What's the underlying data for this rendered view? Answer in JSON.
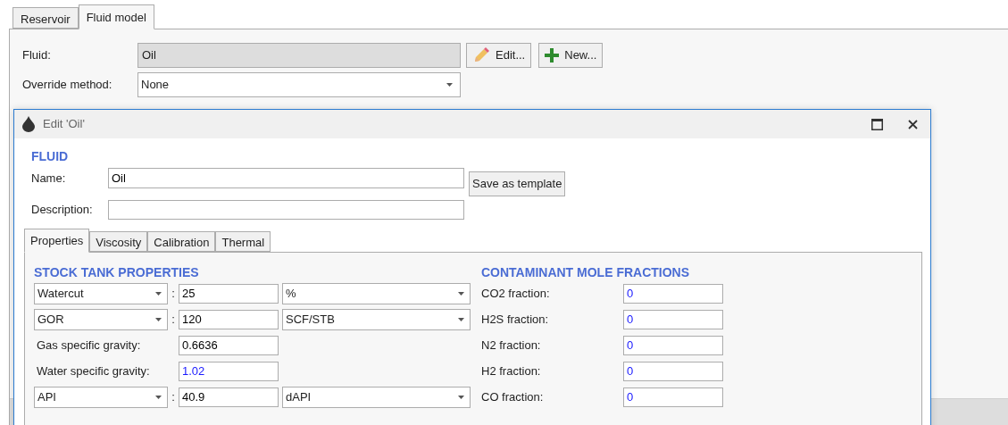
{
  "main_tabs": [
    {
      "label": "Reservoir",
      "selected": false
    },
    {
      "label": "Fluid model",
      "selected": true
    }
  ],
  "fluid": {
    "label": "Fluid:",
    "value": "Oil"
  },
  "fluid_buttons": [
    {
      "kind": "edit",
      "label": "Edit..."
    },
    {
      "kind": "new",
      "label": "New..."
    }
  ],
  "override": {
    "label": "Override method:",
    "value": "None"
  },
  "dialog": {
    "title": "Edit 'Oil'",
    "section": "FLUID",
    "name": {
      "label": "Name:",
      "value": "Oil"
    },
    "save_button": "Save as template",
    "description": {
      "label": "Description:"
    },
    "tabs": [
      {
        "label": "Properties",
        "selected": true
      },
      {
        "label": "Viscosity",
        "selected": false
      },
      {
        "label": "Calibration",
        "selected": false
      },
      {
        "label": "Thermal",
        "selected": false
      }
    ],
    "stock_tank": {
      "heading": "STOCK TANK PROPERTIES",
      "rows": [
        {
          "kind": "selector",
          "property": "Watercut",
          "separator": ":",
          "value": "25",
          "unit": "%",
          "default_value": false
        },
        {
          "kind": "selector",
          "property": "GOR",
          "separator": ":",
          "value": "120",
          "unit": "SCF/STB",
          "default_value": false
        },
        {
          "kind": "fixed",
          "label": "Gas specific gravity:",
          "value": "0.6636",
          "default_value": false
        },
        {
          "kind": "fixed",
          "label": "Water specific gravity:",
          "value": "1.02",
          "default_value": true
        },
        {
          "kind": "selector",
          "property": "API",
          "separator": ":",
          "value": "40.9",
          "unit": "dAPI",
          "default_value": false
        }
      ]
    },
    "contaminants": {
      "heading": "CONTAMINANT MOLE FRACTIONS",
      "rows": [
        {
          "label": "CO2 fraction:",
          "value": "0",
          "default_value": true
        },
        {
          "label": "H2S fraction:",
          "value": "0",
          "default_value": true
        },
        {
          "label": "N2 fraction:",
          "value": "0",
          "default_value": true
        },
        {
          "label": "H2 fraction:",
          "value": "0",
          "default_value": true
        },
        {
          "label": "CO fraction:",
          "value": "0",
          "default_value": true
        }
      ]
    }
  }
}
